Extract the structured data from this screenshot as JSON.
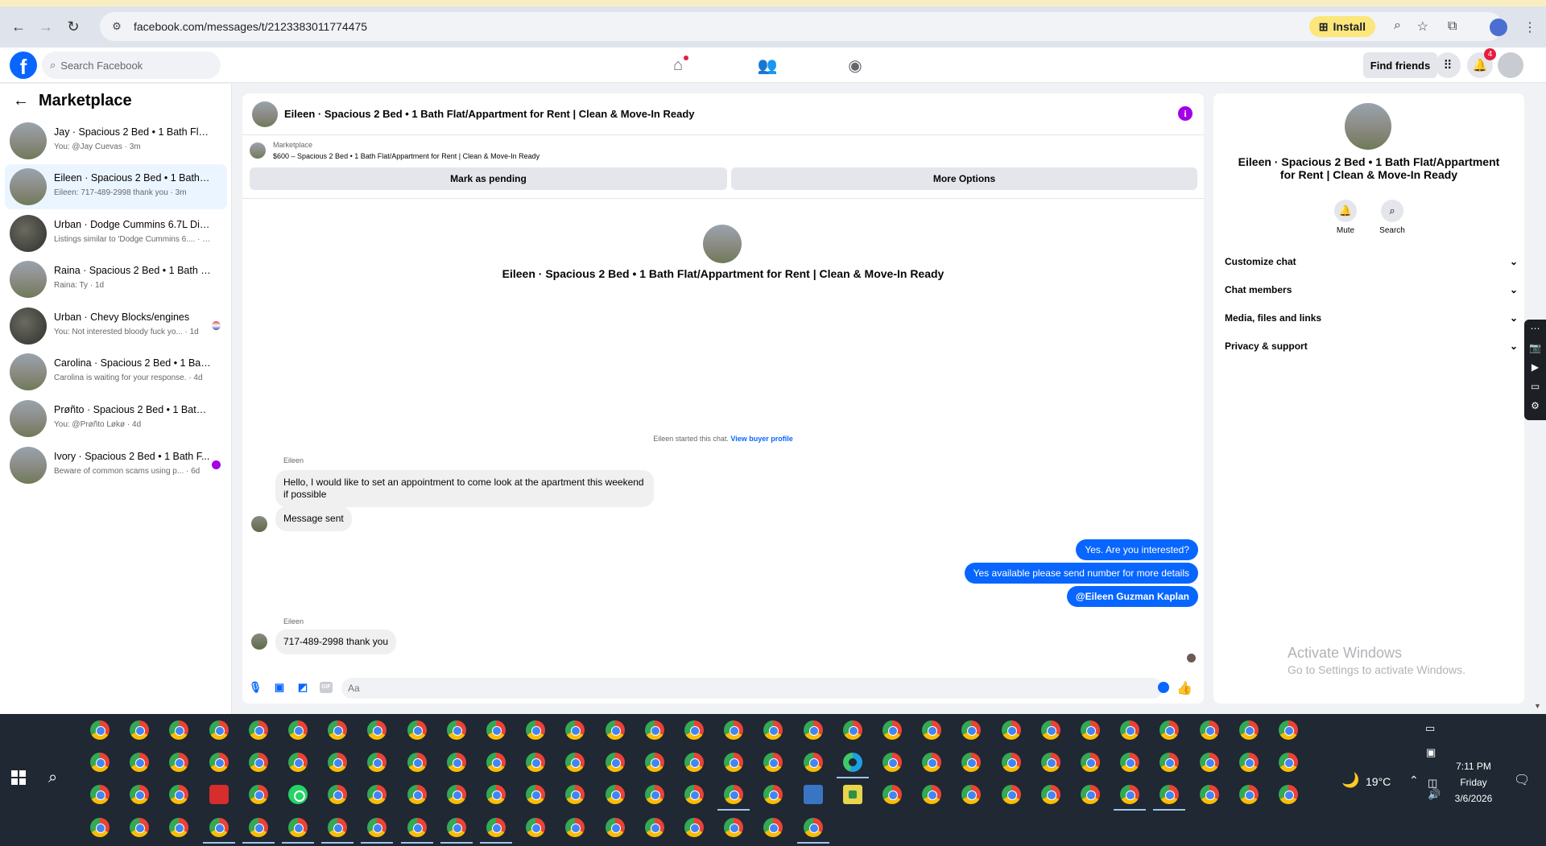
{
  "browser": {
    "url": "facebook.com/messages/t/2123383011774475",
    "install_label": "Install"
  },
  "fb": {
    "search_placeholder": "Search Facebook",
    "find_friends": "Find friends",
    "notif_count": "4"
  },
  "sidebar": {
    "title": "Marketplace",
    "chats": [
      {
        "title": "Jay · Spacious 2 Bed • 1 Bath Flat/...",
        "sub": "You: @Jay Cuevas · 3m"
      },
      {
        "title": "Eileen · Spacious 2 Bed • 1 Bath Fla...",
        "sub": "Eileen: 717-489-2998 thank you · 3m"
      },
      {
        "title": "Urban · Dodge Cummins 6.7L Dies...",
        "sub": "Listings similar to 'Dodge Cummins 6.... · 1d"
      },
      {
        "title": "Raina · Spacious 2 Bed • 1 Bath Fla...",
        "sub": "Raina: Ty · 1d"
      },
      {
        "title": "Urban · Chevy Blocks/engines",
        "sub": "You: Not interested bloody fuck yo... · 1d"
      },
      {
        "title": "Carolina · Spacious 2 Bed • 1 Bath ...",
        "sub": "Carolina is waiting for your response. · 4d"
      },
      {
        "title": "Prøñto · Spacious 2 Bed • 1 Bath Fl...",
        "sub": "You: @Prøñto Løkø · 4d"
      },
      {
        "title": "Ivory · Spacious 2 Bed • 1 Bath F...",
        "sub": "Beware of common scams using p... · 6d"
      }
    ]
  },
  "chat": {
    "header_title": "Eileen · Spacious 2 Bed • 1 Bath Flat/Appartment for Rent | Clean & Move-In Ready",
    "marketplace_label": "Marketplace",
    "listing": "$600 – Spacious 2 Bed • 1 Bath Flat/Appartment for Rent | Clean & Move-In Ready",
    "mark_pending": "Mark as pending",
    "more_options": "More Options",
    "center_title": "Eileen · Spacious 2 Bed • 1 Bath Flat/Appartment for Rent | Clean & Move-In Ready",
    "started_text": "Eileen started this chat.",
    "view_profile": "View buyer profile",
    "sender1": "Eileen",
    "msg1": "Hello, I would like to set an appointment to come look at the apartment this weekend if possible",
    "msg2": "Message sent",
    "out1": "Yes. Are you interested?",
    "out2": "Yes available please send number for more details",
    "out3": "@Eileen Guzman Kaplan",
    "sender2": "Eileen",
    "msg3": "717-489-2998 thank you",
    "composer_placeholder": "Aa"
  },
  "right": {
    "title": "Eileen · Spacious 2 Bed • 1 Bath Flat/Appartment for Rent | Clean & Move-In Ready",
    "mute": "Mute",
    "search": "Search",
    "rows": [
      "Customize chat",
      "Chat members",
      "Media, files and links",
      "Privacy & support"
    ],
    "activate1": "Activate Windows",
    "activate2": "Go to Settings to activate Windows."
  },
  "taskbar": {
    "temp": "19°C",
    "time": "7:11 PM",
    "day": "Friday",
    "date": "3/6/2026"
  }
}
